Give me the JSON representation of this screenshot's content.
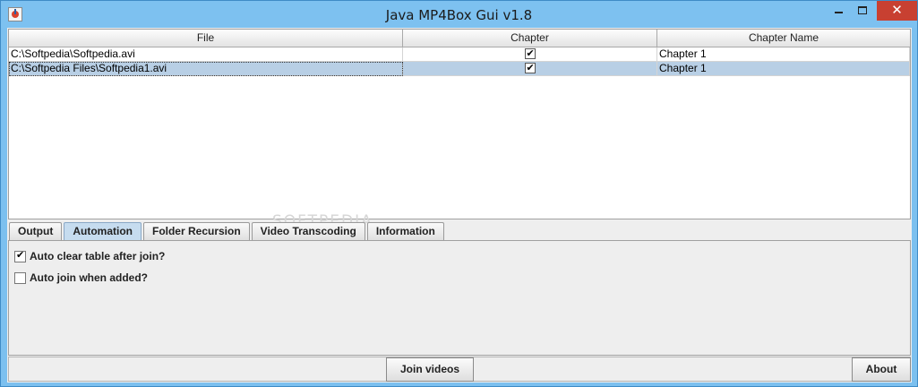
{
  "window": {
    "title": "Java MP4Box Gui v1.8",
    "close_glyph": "✕"
  },
  "table": {
    "columns": [
      "File",
      "Chapter",
      "Chapter Name"
    ],
    "rows": [
      {
        "file": "C:\\Softpedia\\Softpedia.avi",
        "chapter": true,
        "name": "Chapter 1",
        "selected": false
      },
      {
        "file": "C:\\Softpedia Files\\Softpedia1.avi",
        "chapter": true,
        "name": "Chapter 1",
        "selected": true
      }
    ]
  },
  "tabs": [
    {
      "label": "Output",
      "active": false
    },
    {
      "label": "Automation",
      "active": true
    },
    {
      "label": "Folder Recursion",
      "active": false
    },
    {
      "label": "Video Transcoding",
      "active": false
    },
    {
      "label": "Information",
      "active": false
    }
  ],
  "automation": {
    "auto_clear_label": "Auto clear table after join?",
    "auto_clear_checked": true,
    "auto_join_label": "Auto join when added?",
    "auto_join_checked": false
  },
  "buttons": {
    "join": "Join videos",
    "about": "About"
  },
  "watermark": "SOFTPEDIA"
}
